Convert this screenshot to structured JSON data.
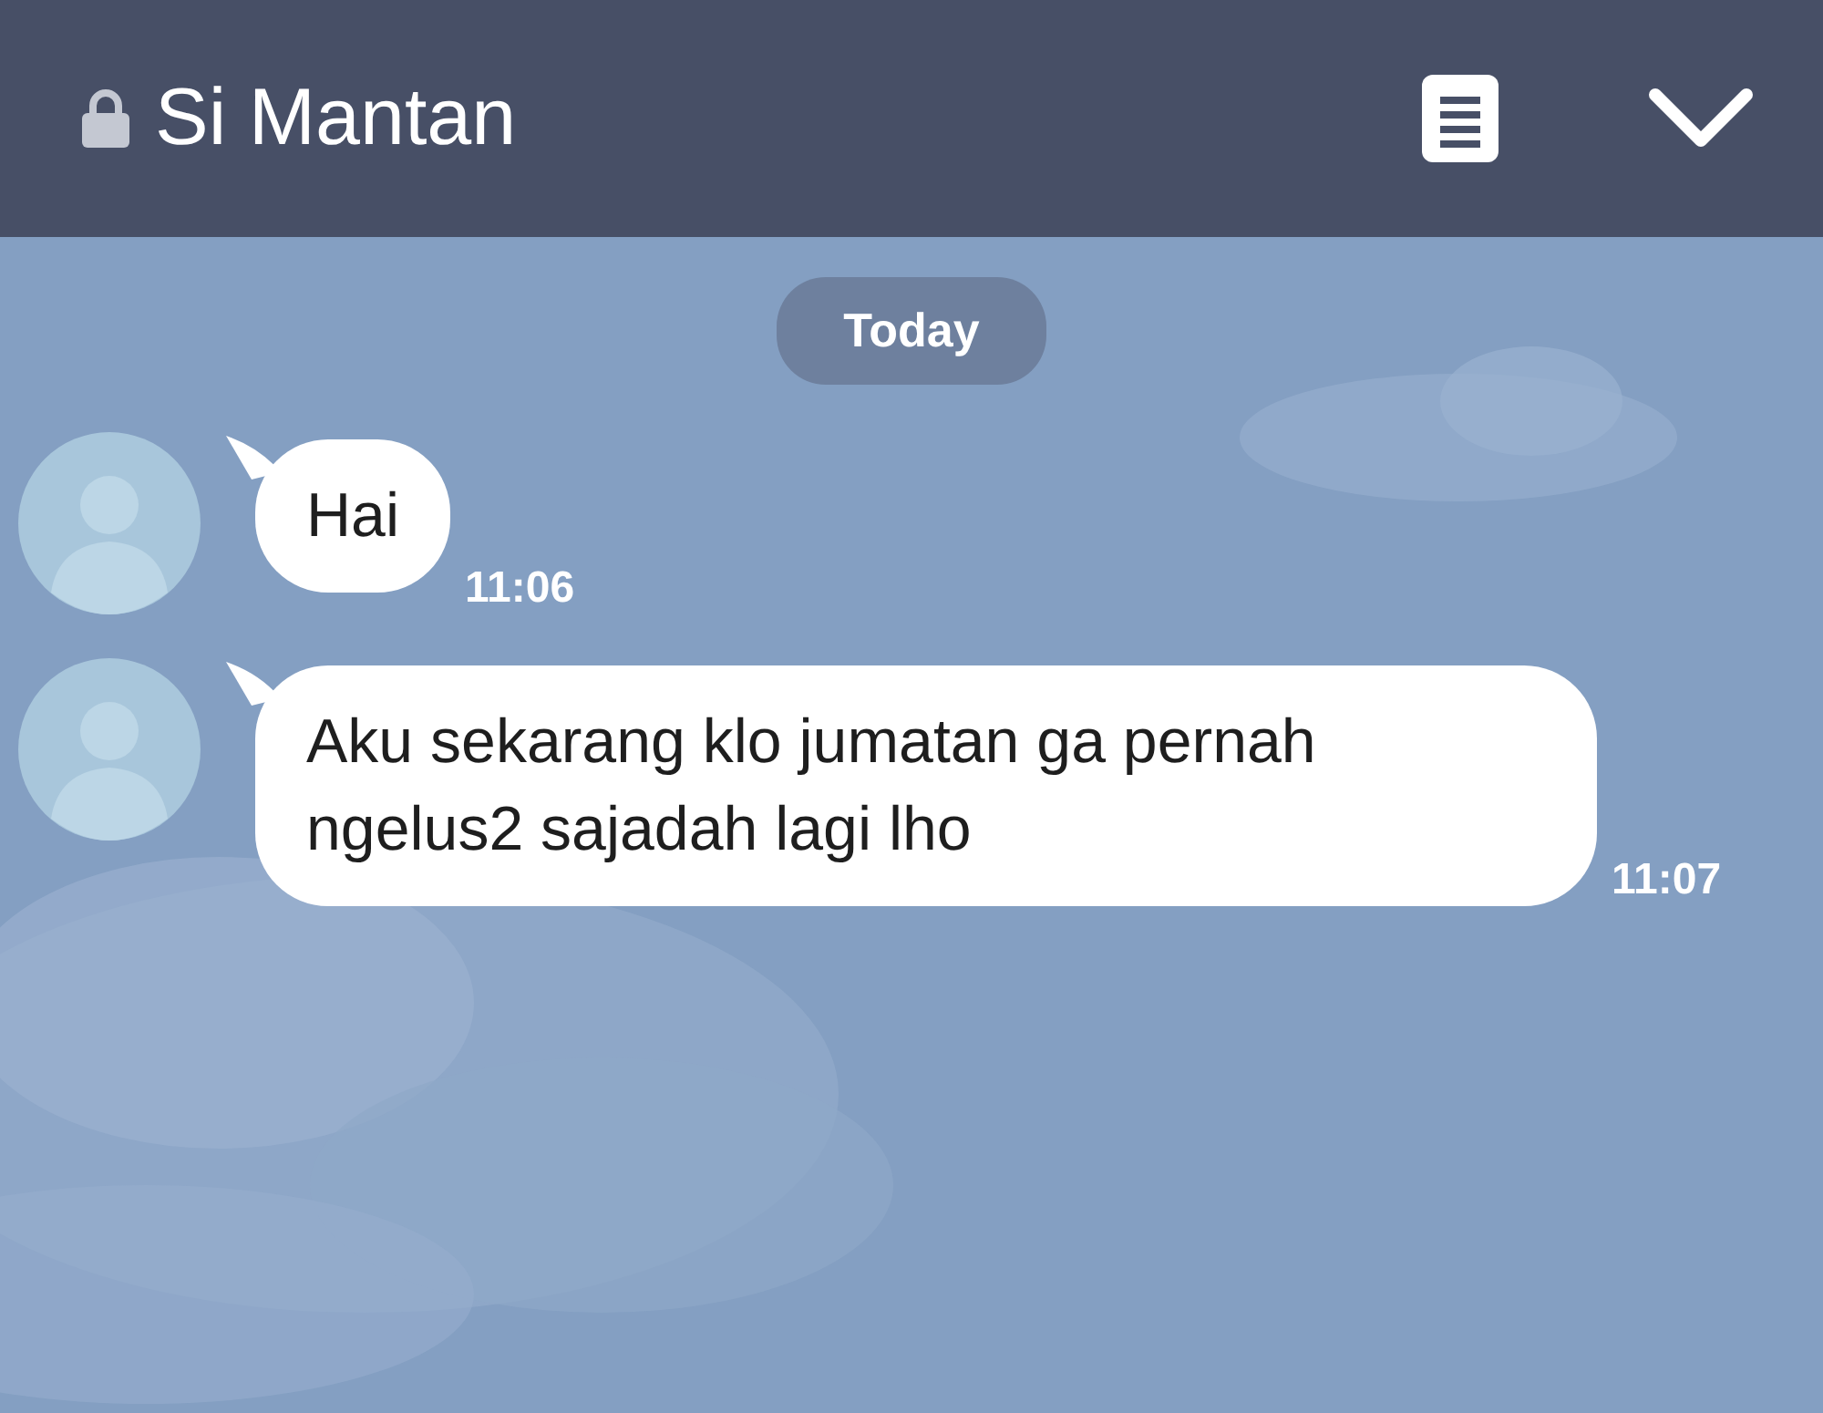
{
  "header": {
    "title": "Si Mantan",
    "locked": true
  },
  "date_divider": "Today",
  "messages": [
    {
      "text": "Hai",
      "time": "11:06"
    },
    {
      "text": "Aku sekarang klo jumatan ga pernah ngelus2 sajadah lagi lho",
      "time": "11:07"
    }
  ]
}
